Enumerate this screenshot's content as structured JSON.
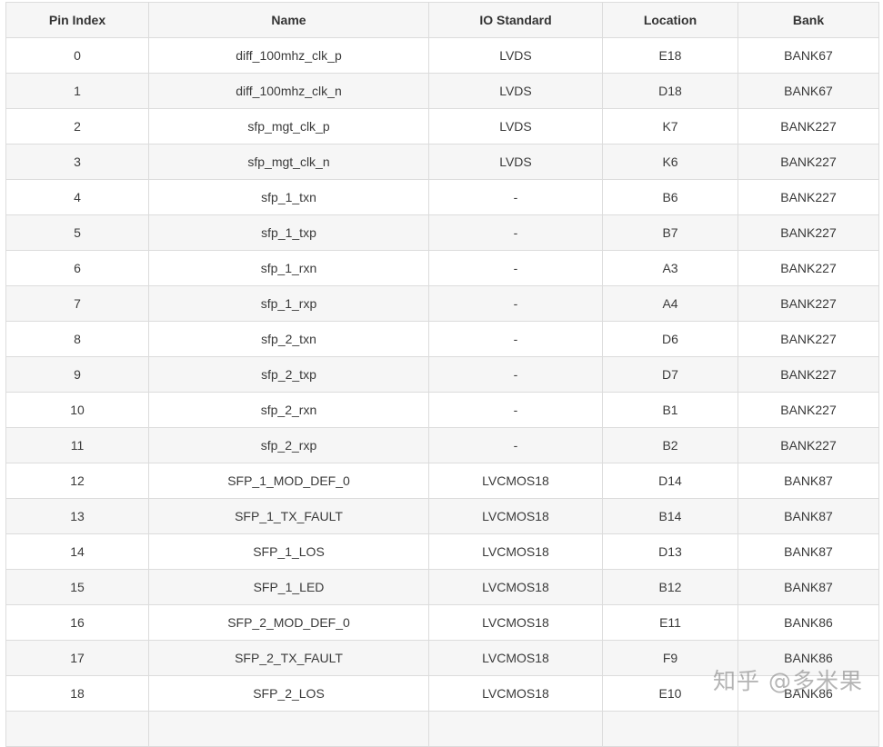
{
  "table": {
    "headers": [
      "Pin Index",
      "Name",
      "IO Standard",
      "Location",
      "Bank"
    ],
    "rows": [
      [
        "0",
        "diff_100mhz_clk_p",
        "LVDS",
        "E18",
        "BANK67"
      ],
      [
        "1",
        "diff_100mhz_clk_n",
        "LVDS",
        "D18",
        "BANK67"
      ],
      [
        "2",
        "sfp_mgt_clk_p",
        "LVDS",
        "K7",
        "BANK227"
      ],
      [
        "3",
        "sfp_mgt_clk_n",
        "LVDS",
        "K6",
        "BANK227"
      ],
      [
        "4",
        "sfp_1_txn",
        "-",
        "B6",
        "BANK227"
      ],
      [
        "5",
        "sfp_1_txp",
        "-",
        "B7",
        "BANK227"
      ],
      [
        "6",
        "sfp_1_rxn",
        "-",
        "A3",
        "BANK227"
      ],
      [
        "7",
        "sfp_1_rxp",
        "-",
        "A4",
        "BANK227"
      ],
      [
        "8",
        "sfp_2_txn",
        "-",
        "D6",
        "BANK227"
      ],
      [
        "9",
        "sfp_2_txp",
        "-",
        "D7",
        "BANK227"
      ],
      [
        "10",
        "sfp_2_rxn",
        "-",
        "B1",
        "BANK227"
      ],
      [
        "11",
        "sfp_2_rxp",
        "-",
        "B2",
        "BANK227"
      ],
      [
        "12",
        "SFP_1_MOD_DEF_0",
        "LVCMOS18",
        "D14",
        "BANK87"
      ],
      [
        "13",
        "SFP_1_TX_FAULT",
        "LVCMOS18",
        "B14",
        "BANK87"
      ],
      [
        "14",
        "SFP_1_LOS",
        "LVCMOS18",
        "D13",
        "BANK87"
      ],
      [
        "15",
        "SFP_1_LED",
        "LVCMOS18",
        "B12",
        "BANK87"
      ],
      [
        "16",
        "SFP_2_MOD_DEF_0",
        "LVCMOS18",
        "E11",
        "BANK86"
      ],
      [
        "17",
        "SFP_2_TX_FAULT",
        "LVCMOS18",
        "F9",
        "BANK86"
      ],
      [
        "18",
        "SFP_2_LOS",
        "LVCMOS18",
        "E10",
        "BANK86"
      ],
      [
        "",
        "",
        "",
        "",
        ""
      ]
    ]
  },
  "watermark": "知乎 @多米果"
}
